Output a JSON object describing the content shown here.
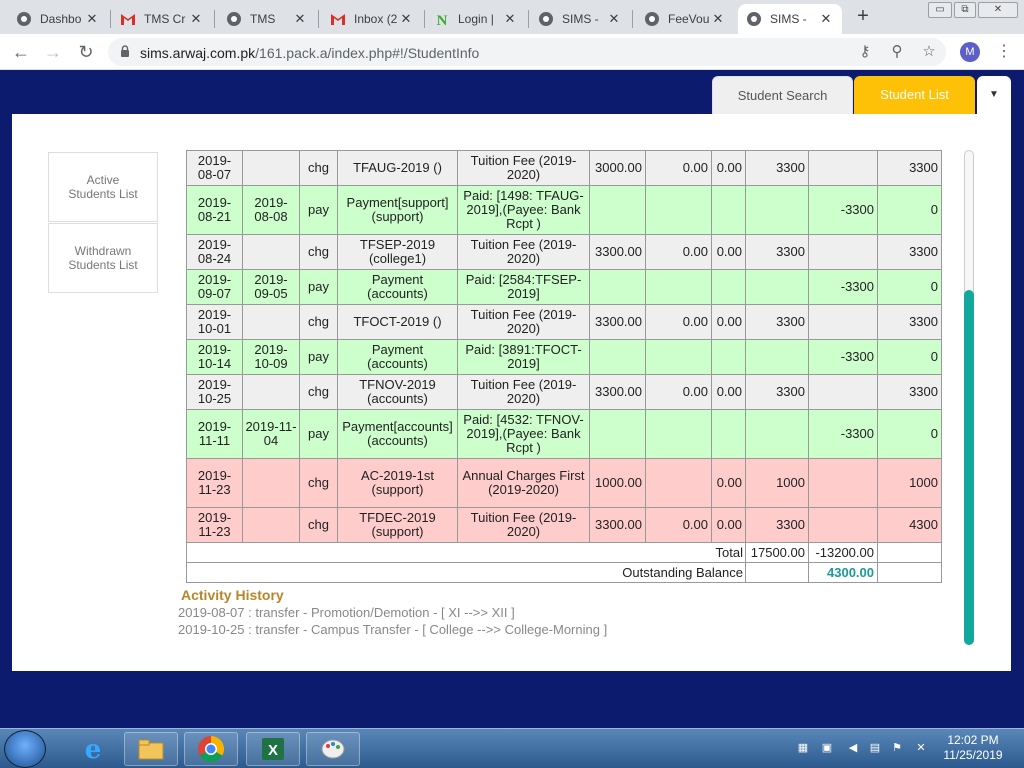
{
  "browser": {
    "tabs": [
      {
        "label": "Dashbo",
        "icon": "chrome-icon"
      },
      {
        "label": "TMS Cr",
        "icon": "gmail-icon"
      },
      {
        "label": "TMS",
        "icon": "chrome-icon"
      },
      {
        "label": "Inbox (2",
        "icon": "gmail-icon"
      },
      {
        "label": "Login |",
        "icon": "login-icon"
      },
      {
        "label": "SIMS - ",
        "icon": "chrome-icon"
      },
      {
        "label": "FeeVou",
        "icon": "chrome-icon"
      },
      {
        "label": "SIMS - ",
        "icon": "chrome-icon"
      }
    ],
    "close_glyph": "✕",
    "new_tab_glyph": "+",
    "url_host": "sims.arwaj.com.pk",
    "url_path": "/161.pack.a/index.php#!/StudentInfo",
    "avatar_initial": "M"
  },
  "page_tabs": {
    "search": "Student Search",
    "list": "Student List",
    "dropdown_glyph": "▼"
  },
  "sidebar": {
    "active": "Active Students List",
    "withdrawn": "Withdrawn Students List"
  },
  "ledger": {
    "rows": [
      {
        "type": "chg",
        "c": [
          "2019-08-07",
          "",
          "chg",
          "TFAUG-2019 ()",
          "Tuition Fee (2019-2020)",
          "3000.00",
          "0.00",
          "0.00",
          "3300",
          "",
          "3300"
        ]
      },
      {
        "type": "pay",
        "c": [
          "2019-08-21",
          "2019-08-08",
          "pay",
          "Payment[support] (support)",
          "Paid: [1498: TFAUG-2019],(Payee: Bank Rcpt )",
          "",
          "",
          "",
          "",
          "-3300",
          "0"
        ]
      },
      {
        "type": "chg",
        "c": [
          "2019-08-24",
          "",
          "chg",
          "TFSEP-2019 (college1)",
          "Tuition Fee (2019-2020)",
          "3300.00",
          "0.00",
          "0.00",
          "3300",
          "",
          "3300"
        ]
      },
      {
        "type": "pay",
        "c": [
          "2019-09-07",
          "2019-09-05",
          "pay",
          "Payment (accounts)",
          "Paid: [2584:TFSEP-2019]",
          "",
          "",
          "",
          "",
          "-3300",
          "0"
        ]
      },
      {
        "type": "chg",
        "c": [
          "2019-10-01",
          "",
          "chg",
          "TFOCT-2019 ()",
          "Tuition Fee (2019-2020)",
          "3300.00",
          "0.00",
          "0.00",
          "3300",
          "",
          "3300"
        ]
      },
      {
        "type": "pay",
        "c": [
          "2019-10-14",
          "2019-10-09",
          "pay",
          "Payment (accounts)",
          "Paid: [3891:TFOCT-2019]",
          "",
          "",
          "",
          "",
          "-3300",
          "0"
        ]
      },
      {
        "type": "chg",
        "c": [
          "2019-10-25",
          "",
          "chg",
          "TFNOV-2019 (accounts)",
          "Tuition Fee (2019-2020)",
          "3300.00",
          "0.00",
          "0.00",
          "3300",
          "",
          "3300"
        ]
      },
      {
        "type": "pay",
        "c": [
          "2019-11-11",
          "2019-11-04",
          "pay",
          "Payment[accounts] (accounts)",
          "Paid: [4532: TFNOV-2019],(Payee: Bank Rcpt )",
          "",
          "",
          "",
          "",
          "-3300",
          "0"
        ]
      },
      {
        "type": "due",
        "c": [
          "2019-11-23",
          "",
          "chg",
          "AC-2019-1st (support)",
          "Annual Charges First (2019-2020)",
          "1000.00",
          "",
          "0.00",
          "1000",
          "",
          "1000"
        ]
      },
      {
        "type": "due",
        "c": [
          "2019-11-23",
          "",
          "chg",
          "TFDEC-2019 (support)",
          "Tuition Fee (2019-2020)",
          "3300.00",
          "0.00",
          "0.00",
          "3300",
          "",
          "4300"
        ]
      }
    ],
    "total_label": "Total",
    "total_debit": "17500.00",
    "total_credit": "-13200.00",
    "balance_label": "Outstanding Balance",
    "balance_value": "4300.00"
  },
  "activity": {
    "title": "Activity History",
    "lines": [
      "2019-08-07 : transfer - Promotion/Demotion - [ XI -->> XII ]",
      "2019-10-25 : transfer - Campus Transfer - [ College -->> College-Morning ]"
    ]
  },
  "taskbar": {
    "time": "12:02 PM",
    "date": "11/25/2019"
  }
}
